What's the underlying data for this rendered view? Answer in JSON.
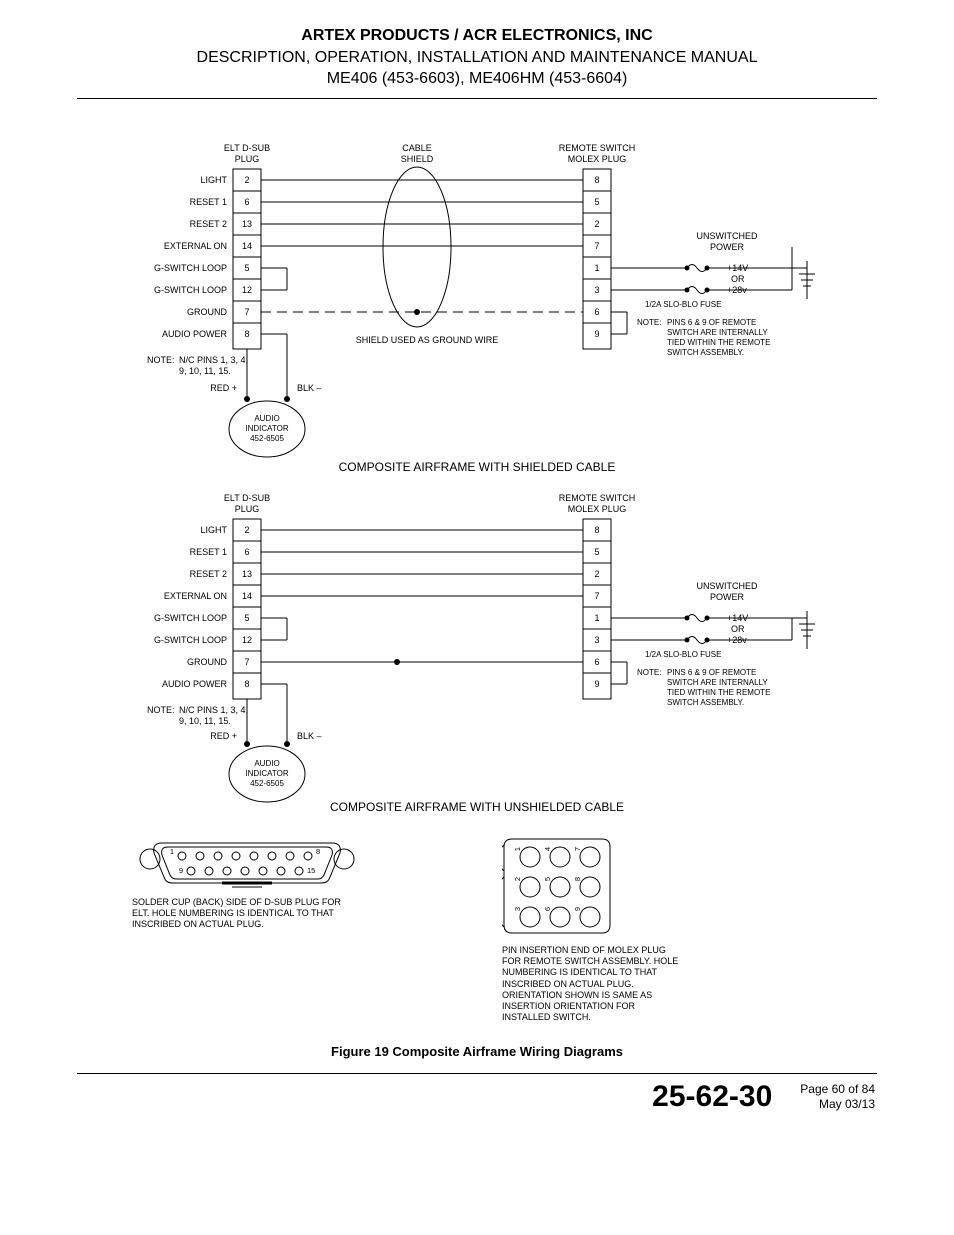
{
  "header": {
    "line1": "ARTEX PRODUCTS / ACR ELECTRONICS, INC",
    "line2": "DESCRIPTION, OPERATION, INSTALLATION AND MAINTENANCE MANUAL",
    "line3": "ME406 (453-6603), ME406HM (453-6604)"
  },
  "diagram1": {
    "elt_plug_label1": "ELT D-SUB",
    "elt_plug_label2": "PLUG",
    "cable_shield1": "CABLE",
    "cable_shield2": "SHIELD",
    "remote_switch1": "REMOTE SWITCH",
    "remote_switch2": "MOLEX PLUG",
    "left_rows": [
      {
        "name": "LIGHT",
        "pin": "2"
      },
      {
        "name": "RESET 1",
        "pin": "6"
      },
      {
        "name": "RESET 2",
        "pin": "13"
      },
      {
        "name": "EXTERNAL ON",
        "pin": "14"
      },
      {
        "name": "G-SWITCH LOOP",
        "pin": "5"
      },
      {
        "name": "G-SWITCH LOOP",
        "pin": "12"
      },
      {
        "name": "GROUND",
        "pin": "7"
      },
      {
        "name": "AUDIO POWER",
        "pin": "8"
      }
    ],
    "right_pins": [
      "8",
      "5",
      "2",
      "7",
      "1",
      "3",
      "6",
      "9"
    ],
    "nc_note1": "NOTE:",
    "nc_note2": "N/C PINS 1, 3, 4,",
    "nc_note3": "9, 10, 11, 15.",
    "red": "RED +",
    "blk": "BLK –",
    "shield_ground": "SHIELD USED AS GROUND WIRE",
    "audio_ind1": "AUDIO",
    "audio_ind2": "INDICATOR",
    "audio_ind3": "452-6505",
    "unswitched1": "UNSWITCHED",
    "unswitched2": "POWER",
    "v14": "+14V",
    "or": "OR",
    "v28": "+28v",
    "fuse": "1/2A SLO-BLO FUSE",
    "pins69_1": "NOTE:",
    "pins69_2": "PINS 6 & 9 OF REMOTE",
    "pins69_3": "SWITCH ARE INTERNALLY",
    "pins69_4": "TIED WITHIN THE REMOTE",
    "pins69_5": "SWITCH ASSEMBLY.",
    "title": "COMPOSITE AIRFRAME WITH SHIELDED CABLE"
  },
  "diagram2": {
    "elt_plug_label1": "ELT D-SUB",
    "elt_plug_label2": "PLUG",
    "remote_switch1": "REMOTE SWITCH",
    "remote_switch2": "MOLEX PLUG",
    "left_rows": [
      {
        "name": "LIGHT",
        "pin": "2"
      },
      {
        "name": "RESET 1",
        "pin": "6"
      },
      {
        "name": "RESET 2",
        "pin": "13"
      },
      {
        "name": "EXTERNAL ON",
        "pin": "14"
      },
      {
        "name": "G-SWITCH LOOP",
        "pin": "5"
      },
      {
        "name": "G-SWITCH LOOP",
        "pin": "12"
      },
      {
        "name": "GROUND",
        "pin": "7"
      },
      {
        "name": "AUDIO POWER",
        "pin": "8"
      }
    ],
    "right_pins": [
      "8",
      "5",
      "2",
      "7",
      "1",
      "3",
      "6",
      "9"
    ],
    "nc_note1": "NOTE:",
    "nc_note2": "N/C PINS 1, 3, 4,",
    "nc_note3": "9, 10, 11, 15.",
    "red": "RED +",
    "blk": "BLK –",
    "audio_ind1": "AUDIO",
    "audio_ind2": "INDICATOR",
    "audio_ind3": "452-6505",
    "unswitched1": "UNSWITCHED",
    "unswitched2": "POWER",
    "v14": "+14V",
    "or": "OR",
    "v28": "+28v",
    "fuse": "1/2A SLO-BLO FUSE",
    "pins69_1": "NOTE:",
    "pins69_2": "PINS 6 & 9 OF REMOTE",
    "pins69_3": "SWITCH ARE INTERNALLY",
    "pins69_4": "TIED WITHIN THE REMOTE",
    "pins69_5": "SWITCH ASSEMBLY.",
    "title": "COMPOSITE AIRFRAME WITH UNSHIELDED CABLE"
  },
  "connectors": {
    "dsub_note": "SOLDER CUP (BACK) SIDE OF D-SUB PLUG FOR ELT.  HOLE NUMBERING IS IDENTICAL TO THAT INSCRIBED ON ACTUAL PLUG.",
    "molex_note": "PIN INSERTION END OF MOLEX PLUG FOR REMOTE SWITCH ASSEMBLY.  HOLE NUMBERING IS IDENTICAL TO THAT INSCRIBED ON ACTUAL PLUG.  ORIENTATION SHOWN IS SAME AS INSERTION ORIENTATION FOR INSTALLED SWITCH.",
    "dsub_top_left": "1",
    "dsub_top_right": "8",
    "dsub_bot_left": "9",
    "dsub_bot_right": "15",
    "molex_pins": [
      "3",
      "2",
      "1",
      "6",
      "5",
      "4",
      "9",
      "8",
      "7"
    ]
  },
  "figure_caption": "Figure 19  Composite Airframe Wiring Diagrams",
  "footer": {
    "doc_number": "25-62-30",
    "page": "Page 60 of 84",
    "date": "May 03/13"
  }
}
